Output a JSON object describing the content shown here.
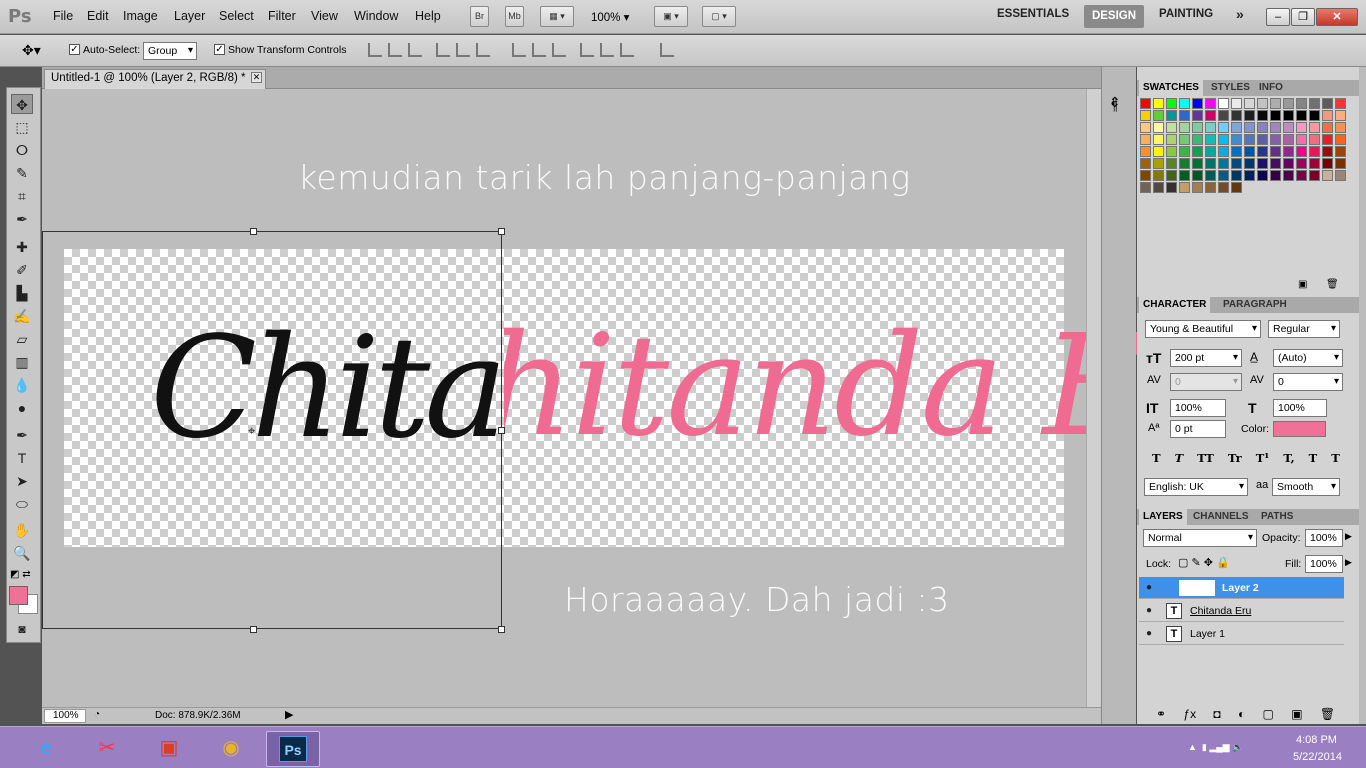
{
  "app": {
    "logo": "Ps"
  },
  "menu": [
    "File",
    "Edit",
    "Image",
    "Layer",
    "Select",
    "Filter",
    "View",
    "Window",
    "Help"
  ],
  "appbar": {
    "bridge": "Br",
    "minibridge": "Mb",
    "zoom": "100%"
  },
  "workspaces": [
    "ESSENTIALS",
    "DESIGN",
    "PAINTING"
  ],
  "options": {
    "auto_select_label": "Auto-Select:",
    "auto_select_value": "Group",
    "show_transform_label": "Show Transform Controls"
  },
  "document": {
    "tab_title": "Untitled-1 @ 100% (Layer 2, RGB/8) *"
  },
  "canvas": {
    "instruction_text": "kemudian tarik lah panjang-panjang",
    "script_pink": "Chitanda Eru",
    "script_black": "Chitan",
    "result_text": "Horaaaaay. Dah jadi :3"
  },
  "status": {
    "zoom": "100%",
    "doc": "Doc: 878.9K/2.36M"
  },
  "swatches": {
    "tabs": [
      "SWATCHES",
      "STYLES",
      "INFO"
    ],
    "colors": [
      "#ff0000",
      "#ffff00",
      "#00ff00",
      "#00ffff",
      "#0000ff",
      "#ff00ff",
      "#ffffff",
      "#ebebeb",
      "#d6d6d6",
      "#c2c2c2",
      "#adadad",
      "#999999",
      "#858585",
      "#707070",
      "#5c5c5c",
      "#ff3333",
      "#ffcc00",
      "#66cc33",
      "#009999",
      "#3366cc",
      "#663399",
      "#cc0066",
      "#474747",
      "#333333",
      "#1f1f1f",
      "#0a0a0a",
      "#000000",
      "#000000",
      "#000000",
      "#000000",
      "#f7977a",
      "#fbad82",
      "#fdc68a",
      "#fff79a",
      "#c4df9b",
      "#a2d39c",
      "#82ca9d",
      "#7bcdc8",
      "#6ecff6",
      "#7ea7d8",
      "#8493ca",
      "#8882be",
      "#a187be",
      "#bc8dbf",
      "#f49ac2",
      "#f6989d",
      "#f26c4f",
      "#f68e55",
      "#fbaf5c",
      "#fff467",
      "#acd372",
      "#7cc576",
      "#3bb878",
      "#1abbb4",
      "#00bff3",
      "#438ccb",
      "#5574b9",
      "#605ca8",
      "#855fa8",
      "#a763a8",
      "#f06ea9",
      "#f26d7d",
      "#ed1c24",
      "#f26522",
      "#f7941d",
      "#fff200",
      "#8dc73f",
      "#39b54a",
      "#00a651",
      "#00a99d",
      "#00aeef",
      "#0072bc",
      "#0054a6",
      "#2e3192",
      "#662d91",
      "#92278f",
      "#ec008c",
      "#ed145b",
      "#9e0b0f",
      "#a0410d",
      "#a36209",
      "#aba000",
      "#598527",
      "#197b30",
      "#007236",
      "#00746b",
      "#0076a3",
      "#004b80",
      "#003471",
      "#1b1464",
      "#440e62",
      "#630460",
      "#9e005d",
      "#9e0039",
      "#790000",
      "#7b2e00",
      "#7d4900",
      "#827b00",
      "#406618",
      "#005e20",
      "#005826",
      "#005952",
      "#005b7f",
      "#003663",
      "#002157",
      "#0d004c",
      "#32004b",
      "#4b0049",
      "#7b0046",
      "#7a0026",
      "#c7b299",
      "#998675",
      "#736357",
      "#534741",
      "#37302d",
      "#c69c6d",
      "#a67c52",
      "#8c6239",
      "#754c24",
      "#603913"
    ]
  },
  "character": {
    "tabs": [
      "CHARACTER",
      "PARAGRAPH"
    ],
    "font_family": "Young & Beautiful",
    "font_style": "Regular",
    "size": "200 pt",
    "leading": "(Auto)",
    "kerning": "0",
    "tracking": "0",
    "vscale": "100%",
    "hscale": "100%",
    "baseline": "0 pt",
    "color_label": "Color:",
    "text_color": "#f0709a",
    "styles": [
      "T",
      "T",
      "TT",
      "Tr",
      "T¹",
      "T,",
      "T",
      "T"
    ],
    "language": "English: UK",
    "aa_label": "aa",
    "aa": "Smooth"
  },
  "layers": {
    "tabs": [
      "LAYERS",
      "CHANNELS",
      "PATHS"
    ],
    "blend": "Normal",
    "opacity_label": "Opacity:",
    "opacity": "100%",
    "lock_label": "Lock:",
    "fill_label": "Fill:",
    "fill": "100%",
    "items": [
      {
        "name": "Layer 2",
        "kind": "image"
      },
      {
        "name": "Chitanda Eru",
        "kind": "text"
      },
      {
        "name": "Layer 1",
        "kind": "text"
      }
    ],
    "text_thumb": "T",
    "eye_glyph": "●"
  },
  "taskbar": {
    "time": "4:08 PM",
    "date": "5/22/2014",
    "ps_label": "Ps"
  }
}
